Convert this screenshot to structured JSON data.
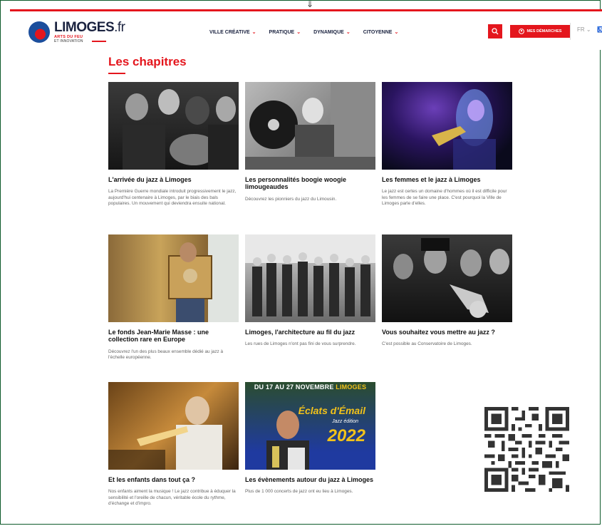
{
  "header": {
    "logo_name": "LIMOGES",
    "logo_tld": ".fr",
    "logo_tag1": "ARTS DU FEU",
    "logo_tag2": "ET INNOVATION",
    "nav": [
      {
        "label": "VILLE CRÉATIVE"
      },
      {
        "label": "PRATIQUE"
      },
      {
        "label": "DYNAMIQUE"
      },
      {
        "label": "CITOYENNE"
      }
    ],
    "demarches_label": "MES DÉMARCHES",
    "lang": "FR"
  },
  "page_title": "Les chapitres",
  "cards": [
    {
      "title": "L'arrivée du jazz à Limoges",
      "desc": "La Première Guerre mondiale introduit progressivement le jazz, aujourd'hui centenaire à Limoges, par le biais des bals populaires. Un mouvement qui deviendra ensuite national."
    },
    {
      "title": "Les personnalités boogie woogie limougeaudes",
      "desc": "Découvrez les pionniers du jazz du Limousin."
    },
    {
      "title": "Les femmes et le jazz à Limoges",
      "desc": "Le jazz est certes un domaine d'hommes où il est difficile pour les femmes de se faire une place. C'est pourquoi la Ville de Limoges parle d'elles."
    },
    {
      "title": "Le fonds Jean-Marie Masse : une collection rare en Europe",
      "desc": "Découvrez l'un des plus beaux ensemble dédié au jazz à l'échelle européenne."
    },
    {
      "title": "Limoges, l'architecture au fil du jazz",
      "desc": "Les rues de Limoges n'ont pas fini de vous surprendre."
    },
    {
      "title": "Vous souhaitez vous mettre au jazz ?",
      "desc": "C'est possible au Conservatoire de Limoges."
    },
    {
      "title": "Et les enfants dans tout ça ?",
      "desc": "Nos enfants aiment la musique ! Le jazz contribue à éduquer la sensibilité et l'oreille de chacun, véritable école du rythme, d'échange et d'impro."
    },
    {
      "title": "Les évènements autour du jazz à Limoges",
      "desc": "Plus de 1 000 concerts de jazz ont eu lieu à Limoges."
    }
  ],
  "poster": {
    "dates": "DU 17 AU 27 NOVEMBRE",
    "city": "LIMOGES",
    "festival": "Éclats d'Émail",
    "edition": "Jazz édition",
    "year": "2022"
  },
  "colors": {
    "accent": "#e4161d",
    "navy": "#1b2340",
    "frame": "#0d5a2a"
  },
  "icons": {
    "search": "search-icon",
    "demarches": "user-icon",
    "lang_chevron": "chevron-down-icon"
  }
}
